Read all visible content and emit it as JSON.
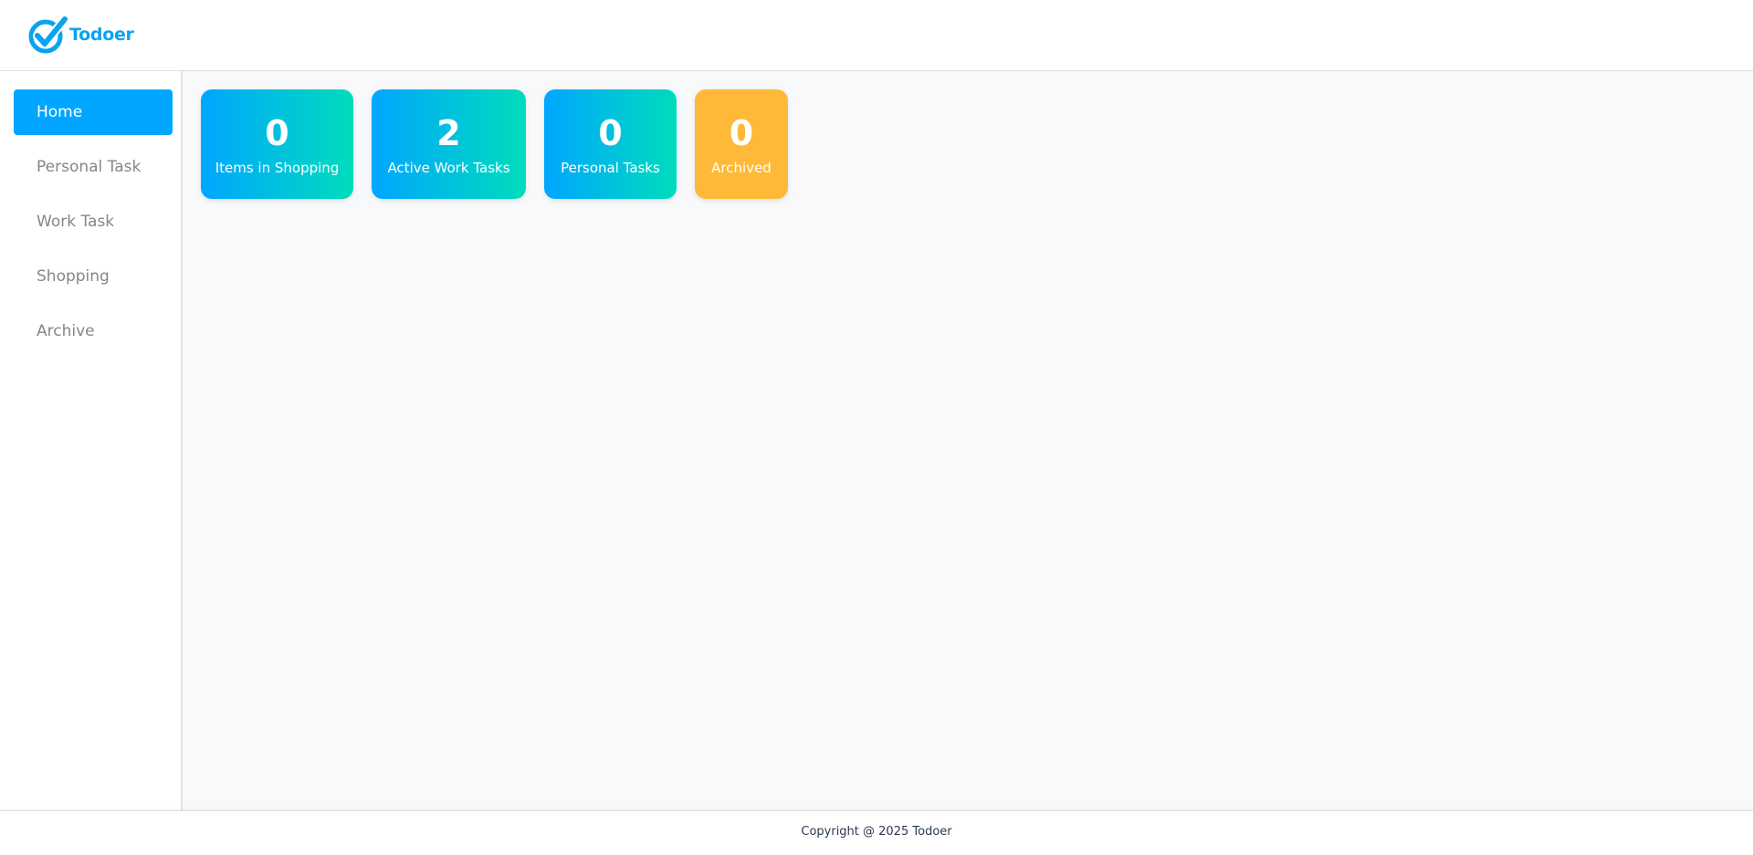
{
  "app": {
    "logo_text": "Todoer",
    "logo_icon": "check-circle-icon",
    "brand_color": "#0aa3f0"
  },
  "sidebar": {
    "items": [
      {
        "label": "Home",
        "active": true
      },
      {
        "label": "Personal Task",
        "active": false
      },
      {
        "label": "Work Task",
        "active": false
      },
      {
        "label": "Shopping",
        "active": false
      },
      {
        "label": "Archive",
        "active": false
      }
    ]
  },
  "stats": [
    {
      "value": "0",
      "label": "Items in Shopping",
      "color": "#00a6ff"
    },
    {
      "value": "2",
      "label": "Active Work Tasks",
      "color": "#00a6ff"
    },
    {
      "value": "0",
      "label": "Personal Tasks",
      "color": "#00a6ff"
    },
    {
      "value": "0",
      "label": "Archived",
      "color": "#ffb938"
    }
  ],
  "footer": {
    "text": "Copyright @ 2025 Todoer"
  }
}
